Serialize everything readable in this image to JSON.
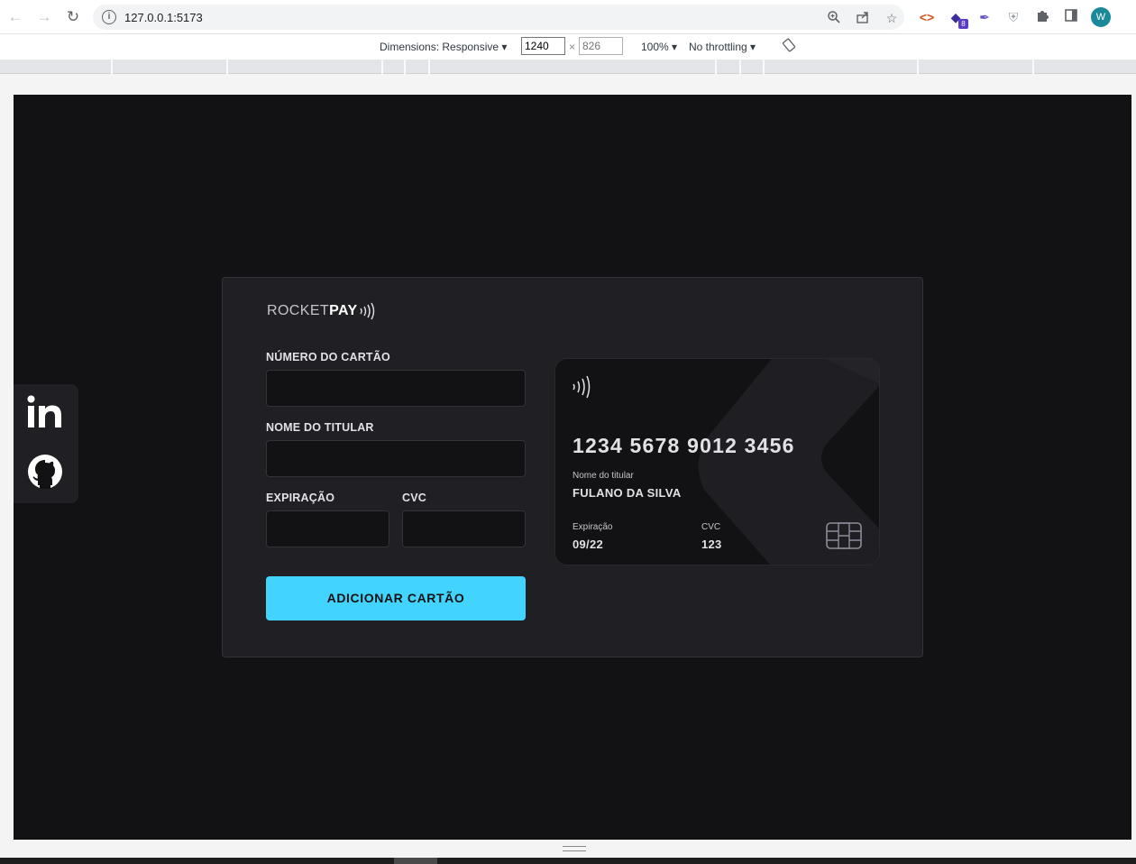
{
  "browser": {
    "url": "127.0.0.1:5173",
    "profile_initial": "W",
    "extension_badge": "8",
    "icons": [
      "back-icon",
      "forward-icon",
      "reload-icon",
      "site-info-icon",
      "zoom-icon",
      "share-icon",
      "bookmark-star-icon",
      "extensions-puzzle-icon",
      "side-panel-icon"
    ]
  },
  "devtools": {
    "dimensions_label": "Dimensions: Responsive",
    "width": "1240",
    "height_placeholder": "826",
    "times": "×",
    "zoom": "100%",
    "throttling": "No throttling"
  },
  "social": {
    "items": [
      {
        "name": "linkedin-icon",
        "label": "in"
      },
      {
        "name": "github-icon"
      }
    ]
  },
  "app": {
    "logo_light": "ROCKET",
    "logo_bold": "PAY",
    "form": {
      "card_number_label": "NÚMERO DO CARTÃO",
      "card_number_value": "",
      "holder_label": "NOME DO TITULAR",
      "holder_value": "",
      "expiration_label": "EXPIRAÇÃO",
      "expiration_value": "",
      "cvc_label": "CVC",
      "cvc_value": "",
      "submit_label": "ADICIONAR CARTÃO"
    },
    "card_preview": {
      "number": "1234 5678 9012 3456",
      "holder_caption": "Nome do titular",
      "holder_name": "FULANO DA SILVA",
      "expiration_caption": "Expiração",
      "expiration_value": "09/22",
      "cvc_caption": "CVC",
      "cvc_value": "123"
    }
  },
  "colors": {
    "background": "#121214",
    "panel": "#202024",
    "accent": "#42d3ff",
    "text": "#e1e1e6"
  }
}
